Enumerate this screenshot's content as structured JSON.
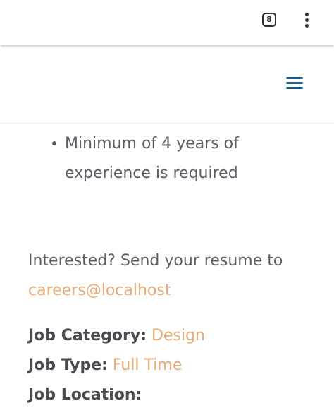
{
  "browser": {
    "tab_count": "8",
    "menu_icon": "more-vert-icon"
  },
  "header": {
    "menu_icon": "hamburger-menu-icon"
  },
  "job": {
    "requirement": "Minimum of 4 years of experience is required",
    "interest_text": "Interested? Send your resume to",
    "email": "careers@localhost",
    "category_label": "Job Category:",
    "category_value": "Design",
    "type_label": "Job Type:",
    "type_value": "Full Time",
    "location_label": "Job Location:",
    "location_value": ""
  },
  "colors": {
    "accent": "#e7ac79",
    "text": "#5d5d66",
    "menu": "#1f5f8b"
  }
}
